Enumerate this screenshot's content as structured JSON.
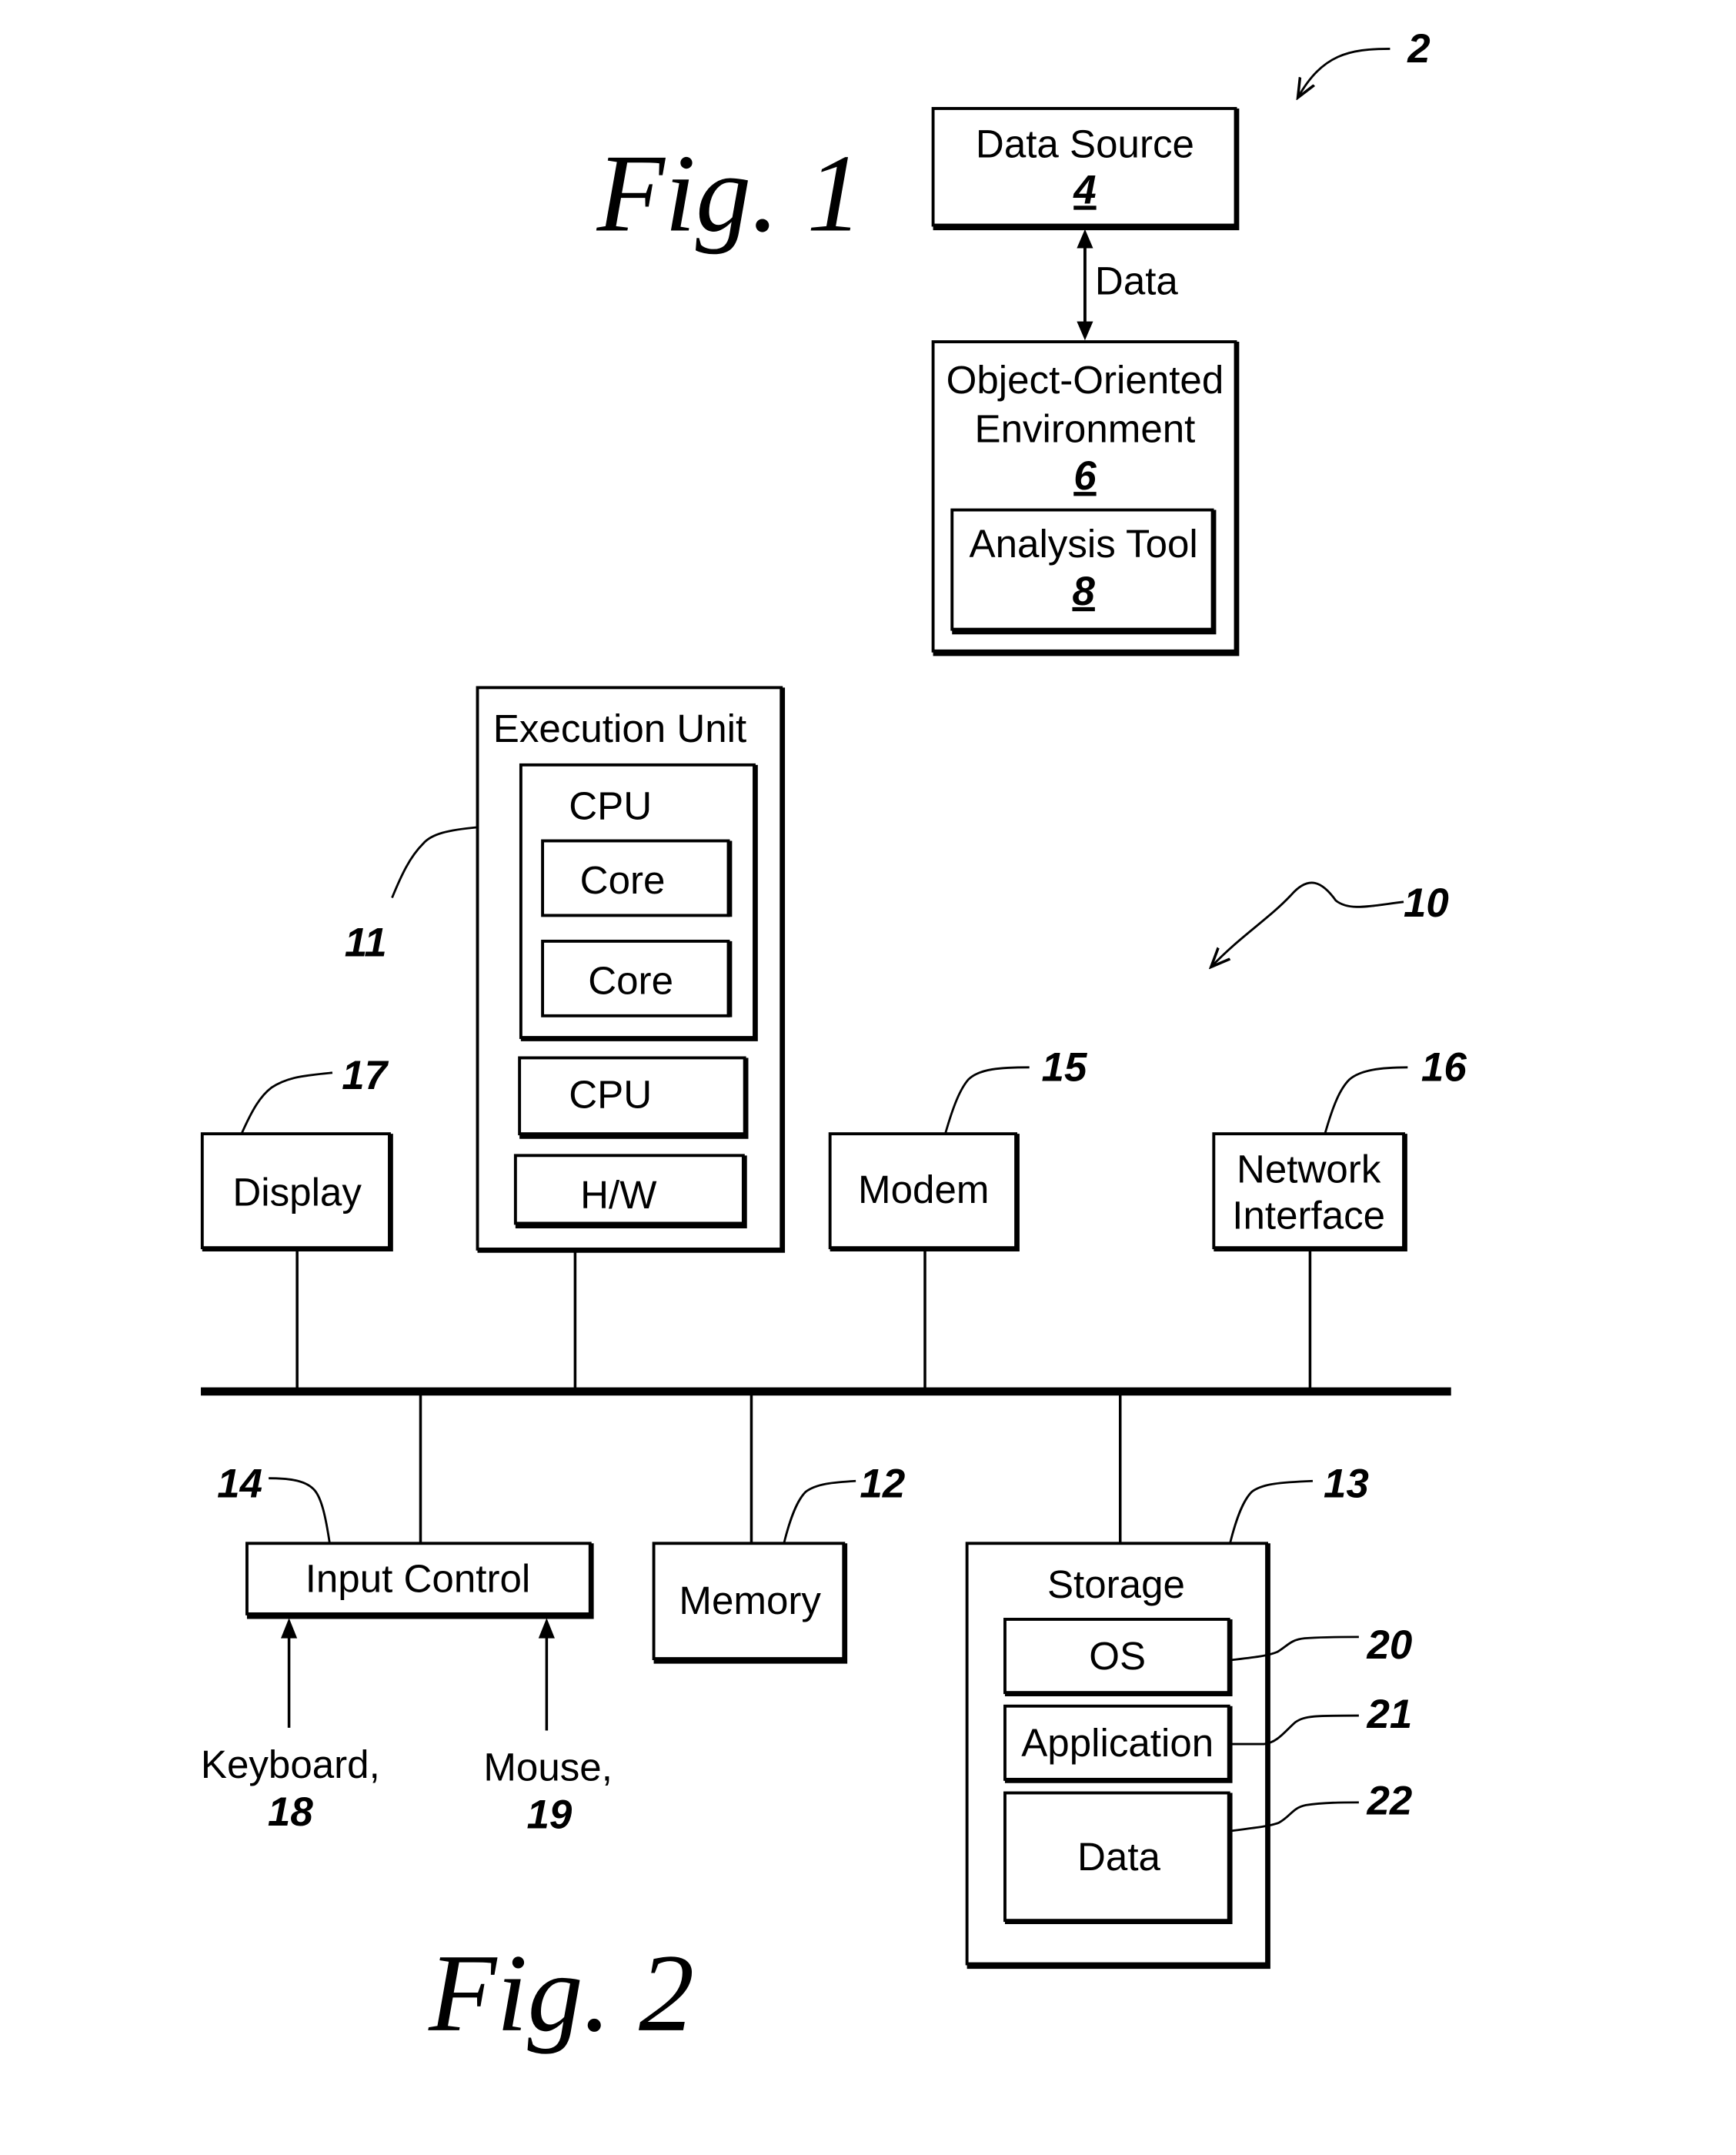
{
  "fig1": {
    "title": "Fig. 1",
    "ref": "2",
    "data_source": {
      "label": "Data Source",
      "ref": "4"
    },
    "connector_label": "Data",
    "environment": {
      "label_line1": "Object-Oriented",
      "label_line2": "Environment",
      "ref": "6"
    },
    "analysis_tool": {
      "label": "Analysis Tool",
      "ref": "8"
    }
  },
  "fig2": {
    "title": "Fig. 2",
    "ref": "10",
    "execution_unit": {
      "label": "Execution Unit",
      "ref": "11",
      "cpu_multi": {
        "label": "CPU",
        "cores": [
          "Core",
          "Core"
        ]
      },
      "cpu_single": {
        "label": "CPU"
      },
      "hw": {
        "label": "H/W"
      }
    },
    "display": {
      "label": "Display",
      "ref": "17"
    },
    "modem": {
      "label": "Modem",
      "ref": "15"
    },
    "network_interface": {
      "label_line1": "Network",
      "label_line2": "Interface",
      "ref": "16"
    },
    "input_control": {
      "label": "Input Control",
      "ref": "14"
    },
    "keyboard": {
      "label": "Keyboard,",
      "ref": "18"
    },
    "mouse": {
      "label": "Mouse,",
      "ref": "19"
    },
    "memory": {
      "label": "Memory",
      "ref": "12"
    },
    "storage": {
      "label": "Storage",
      "ref": "13",
      "items": [
        {
          "label": "OS",
          "ref": "20"
        },
        {
          "label": "Application",
          "ref": "21"
        },
        {
          "label": "Data",
          "ref": "22"
        }
      ]
    }
  }
}
